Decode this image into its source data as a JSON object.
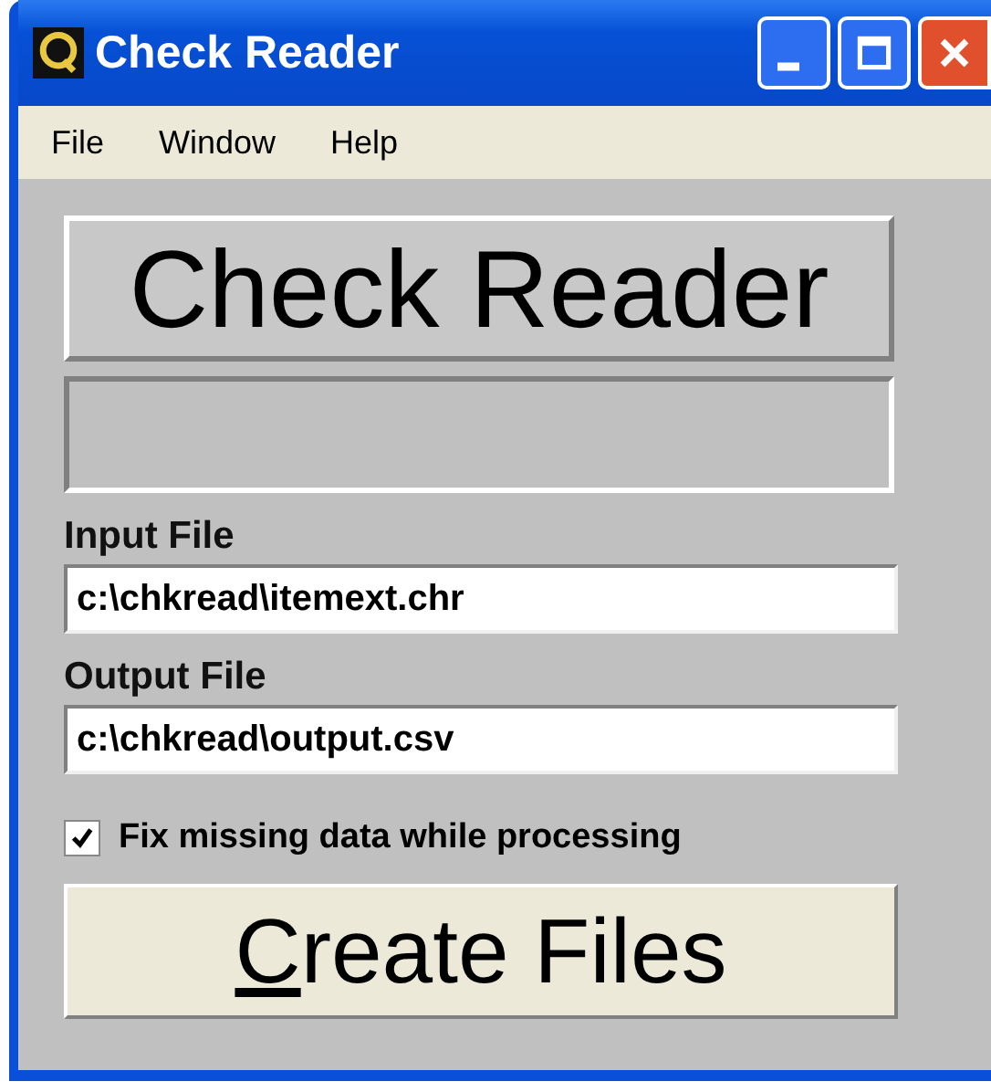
{
  "window": {
    "title": "Check Reader"
  },
  "menu": [
    {
      "label": "File"
    },
    {
      "label": "Window"
    },
    {
      "label": "Help"
    }
  ],
  "banner": {
    "text": "Check Reader"
  },
  "fields": [
    {
      "label": "Input File",
      "value": "c:\\chkread\\itemext.chr"
    },
    {
      "label": "Output File",
      "value": "c:\\chkread\\output.csv"
    }
  ],
  "option": {
    "label": "Fix missing data while processing",
    "checked": true
  },
  "button": {
    "label": "Create Files",
    "mnemonic_first": true
  }
}
